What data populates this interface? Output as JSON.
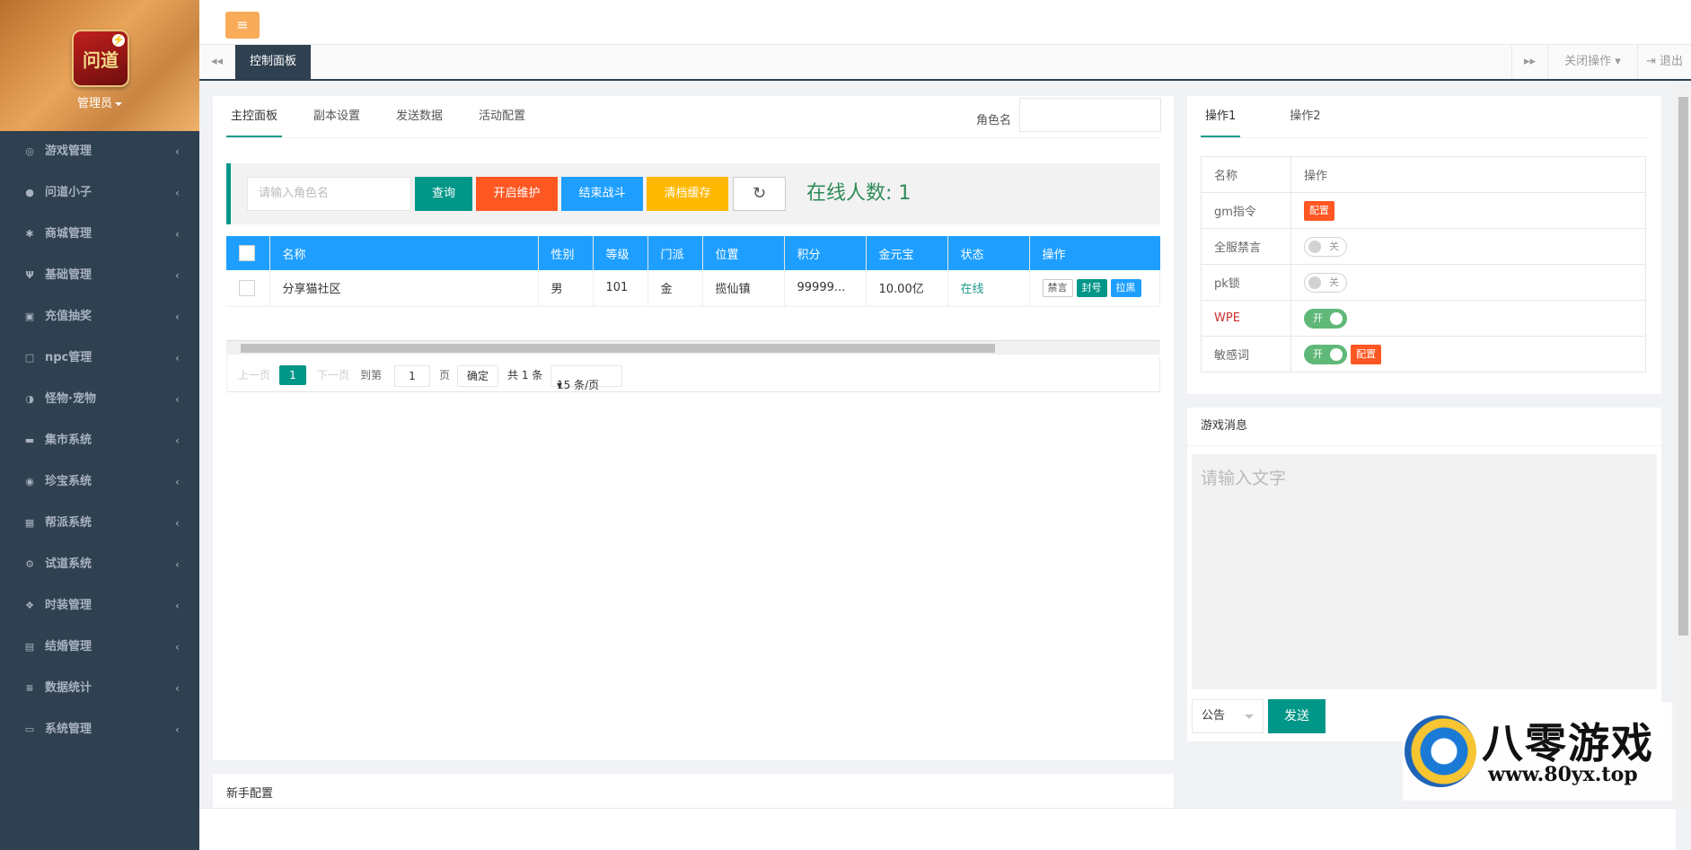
{
  "sidebar": {
    "logo_char": "问道",
    "admin_label": "管理员",
    "items": [
      {
        "label": "游戏管理",
        "icon": "gamepad-icon",
        "glyph": "◎"
      },
      {
        "label": "问道小子",
        "icon": "user-icon",
        "glyph": "●"
      },
      {
        "label": "商城管理",
        "icon": "star-icon",
        "glyph": "✱"
      },
      {
        "label": "基础管理",
        "icon": "cutlery-icon",
        "glyph": "Ψ"
      },
      {
        "label": "充值抽奖",
        "icon": "money-icon",
        "glyph": "▣"
      },
      {
        "label": "npc管理",
        "icon": "square-icon",
        "glyph": "□"
      },
      {
        "label": "怪物·宠物",
        "icon": "adjust-icon",
        "glyph": "◑"
      },
      {
        "label": "集市系统",
        "icon": "bed-icon",
        "glyph": "▬"
      },
      {
        "label": "珍宝系统",
        "icon": "dot-circle-icon",
        "glyph": "◉"
      },
      {
        "label": "帮派系统",
        "icon": "table-icon",
        "glyph": "▦"
      },
      {
        "label": "试道系统",
        "icon": "cogs-icon",
        "glyph": "⚙"
      },
      {
        "label": "时装管理",
        "icon": "cubes-icon",
        "glyph": "❖"
      },
      {
        "label": "结婚管理",
        "icon": "calendar-icon",
        "glyph": "▤"
      },
      {
        "label": "数据统计",
        "icon": "database-icon",
        "glyph": "≡"
      },
      {
        "label": "系统管理",
        "icon": "desktop-icon",
        "glyph": "▭"
      }
    ],
    "arrow": "‹"
  },
  "header": {
    "menu_glyph": "≡",
    "tab_active": "控制面板",
    "close_ops": "关闭操作",
    "logout": "退出",
    "left_glyph": "◂◂",
    "right_glyph": "▸▸"
  },
  "main": {
    "tabs": [
      "主控面板",
      "副本设置",
      "发送数据",
      "活动配置"
    ],
    "role_label": "角色名",
    "search_placeholder": "请输入角色名",
    "buttons": {
      "query": "查询",
      "maintenance": "开启维护",
      "end_battle": "结束战斗",
      "clear_cache": "清档缓存"
    },
    "refresh_glyph": "↻",
    "online_text": "在线人数: 1",
    "columns": [
      "名称",
      "性别",
      "等级",
      "门派",
      "位置",
      "积分",
      "金元宝",
      "状态",
      "操作"
    ],
    "rows": [
      {
        "name": "分享猫社区",
        "gender": "男",
        "level": "101",
        "school": "金",
        "location": "揽仙镇",
        "score": "99999...",
        "gold": "10.00亿",
        "status": "在线",
        "act1": "禁言",
        "act2": "封号",
        "act3": "拉黑"
      }
    ],
    "pager": {
      "prev": "上一页",
      "page": "1",
      "next": "下一页",
      "goto": "到第",
      "input": "1",
      "page_unit": "页",
      "confirm": "确定",
      "total": "共 1 条",
      "size": "15 条/页"
    },
    "newbie_title": "新手配置"
  },
  "right": {
    "tabs": [
      "操作1",
      "操作2"
    ],
    "table": {
      "h_name": "名称",
      "h_op": "操作",
      "rows": [
        {
          "name": "gm指令",
          "type": "tag",
          "tag": "配置"
        },
        {
          "name": "全服禁言",
          "type": "off",
          "sw": "关"
        },
        {
          "name": "pk锁",
          "type": "off",
          "sw": "关"
        },
        {
          "name": "WPE",
          "type": "on",
          "sw": "开"
        },
        {
          "name": "敏感词",
          "type": "on",
          "sw": "开",
          "tag": "配置"
        }
      ]
    },
    "msg_title": "游戏消息",
    "msg_placeholder": "请输入文字",
    "msg_type": "公告",
    "send": "发送"
  },
  "watermark": {
    "name": "八零游戏",
    "url": "www.80yx.top"
  },
  "colors": {
    "sidebar": "#2f4050",
    "teal": "#009688",
    "orange": "#ff5722",
    "blue": "#1e9fff",
    "yellow": "#ffb800",
    "green": "#5fb878"
  }
}
